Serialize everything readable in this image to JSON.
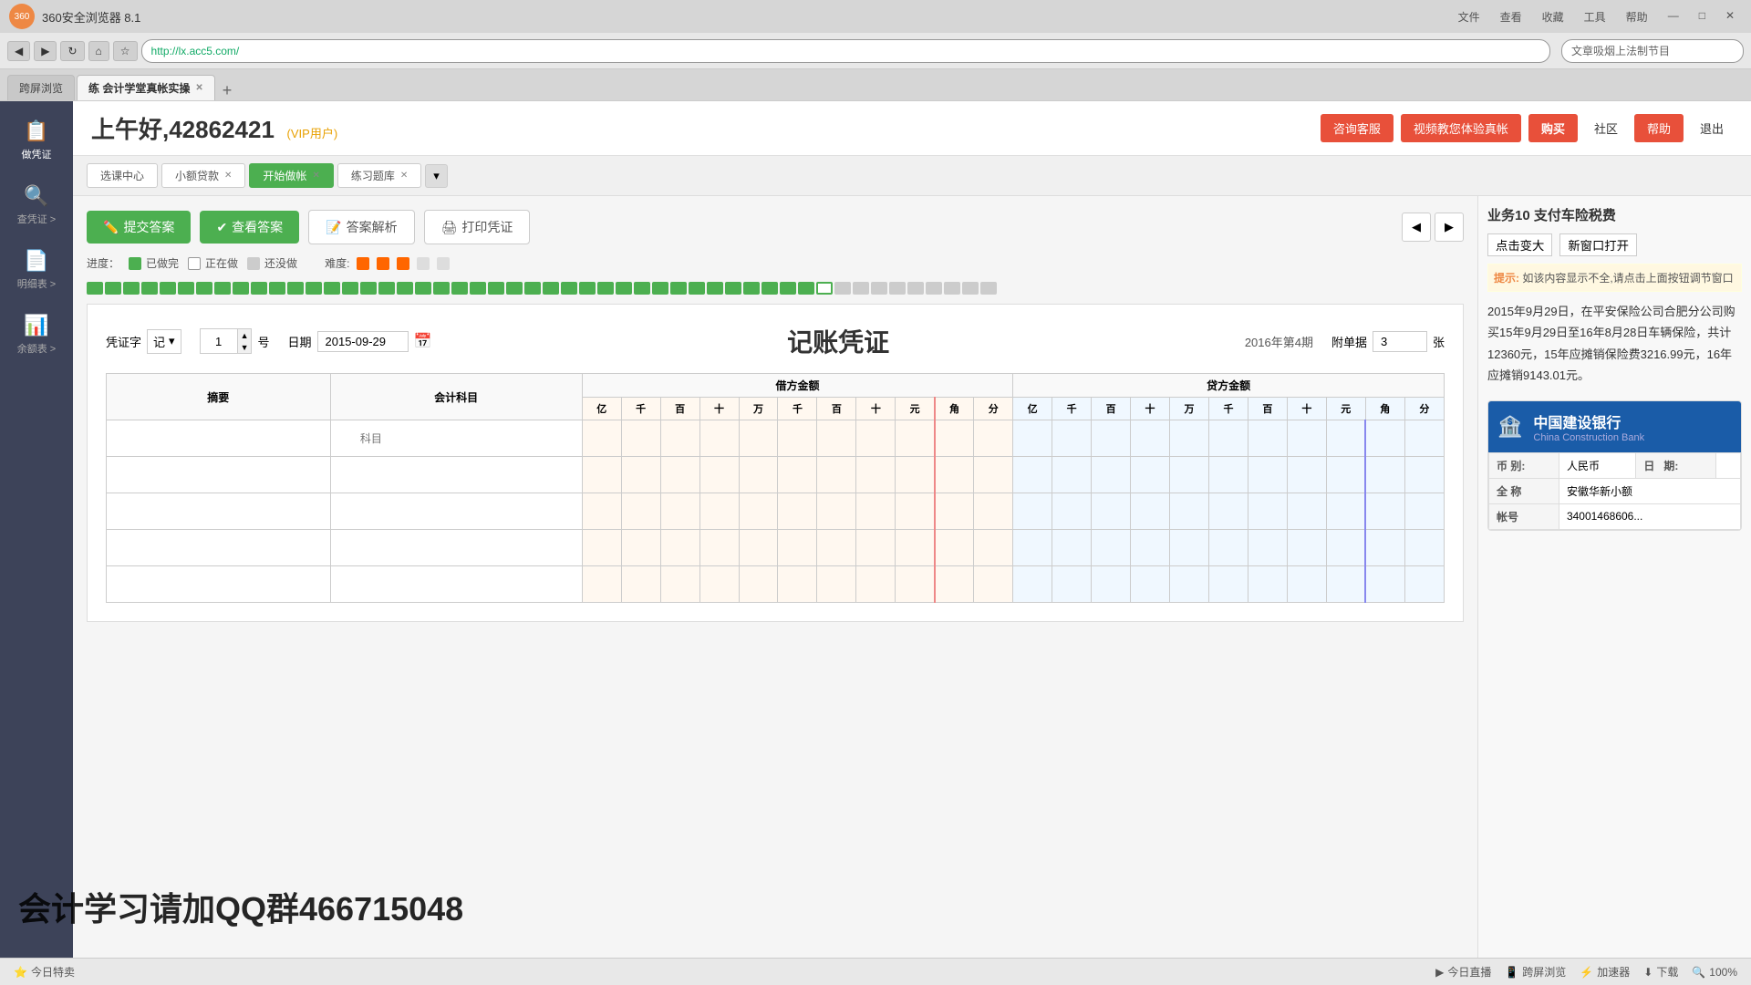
{
  "browser": {
    "title": "360安全浏览器 8.1",
    "url": "http://lx.acc5.com/",
    "search_placeholder": "文章吸烟上法制节目",
    "tabs": [
      {
        "label": "跨屏浏览",
        "active": false,
        "closable": false
      },
      {
        "label": "练 会计学堂真帐实操",
        "active": true,
        "closable": true
      }
    ],
    "window_controls": [
      "文件",
      "查看",
      "收藏",
      "工具",
      "帮助"
    ]
  },
  "header": {
    "greeting": "上午好,42862421",
    "vip_label": "(VIP用户)",
    "buttons": {
      "consult": "咨询客服",
      "video": "视频教您体验真帐",
      "buy": "购买",
      "community": "社区",
      "help": "帮助",
      "exit": "退出"
    }
  },
  "content_tabs": [
    {
      "label": "选课中心",
      "active": false,
      "closable": false
    },
    {
      "label": "小额贷款",
      "active": false,
      "closable": true
    },
    {
      "label": "开始做帐",
      "active": true,
      "closable": true
    },
    {
      "label": "练习题库",
      "active": false,
      "closable": true
    }
  ],
  "action_bar": {
    "submit": "提交答案",
    "answer": "查看答案",
    "analysis": "答案解析",
    "print": "打印凭证"
  },
  "progress": {
    "legend_done": "已做完",
    "legend_doing": "正在做",
    "legend_todo": "还没做",
    "difficulty_label": "难度:",
    "total_cells": 50,
    "done_cells": 40,
    "current_cell": 41
  },
  "voucher": {
    "type_label": "凭证字",
    "type_value": "记",
    "number_label": "号",
    "number_value": "1",
    "date_label": "日期",
    "date_value": "2015-09-29",
    "title": "记账凭证",
    "period": "2016年第4期",
    "attachment_label": "附单据",
    "attachment_value": "3",
    "attachment_unit": "张",
    "table": {
      "col_summary": "摘要",
      "col_account": "会计科目",
      "debit_header": "借方金额",
      "credit_header": "贷方金额",
      "num_headers": [
        "亿",
        "千",
        "百",
        "+",
        "万",
        "千",
        "百",
        "+",
        "元",
        "角",
        "分",
        "亿",
        "千",
        "百",
        "+",
        "万",
        "千",
        "百",
        "+",
        "元",
        "角",
        "分"
      ],
      "account_placeholder": "科目",
      "rows": [
        {
          "summary": "",
          "account": "",
          "debit": "",
          "credit": ""
        },
        {
          "summary": "",
          "account": "",
          "debit": "",
          "credit": ""
        },
        {
          "summary": "",
          "account": "",
          "debit": "",
          "credit": ""
        },
        {
          "summary": "",
          "account": "",
          "debit": "",
          "credit": ""
        },
        {
          "summary": "",
          "account": "",
          "debit": "",
          "credit": ""
        }
      ]
    }
  },
  "sidebar": {
    "items": [
      {
        "label": "做凭证",
        "icon": "📋"
      },
      {
        "label": "查凭证 >",
        "icon": "🔍"
      },
      {
        "label": "明细表 >",
        "icon": "📄"
      },
      {
        "label": "余额表 >",
        "icon": "📊"
      }
    ]
  },
  "right_panel": {
    "business_title": "业务10  支付车险税费",
    "zoom_label": "点击变大",
    "new_window_label": "新窗口打开",
    "hint_label": "提示:",
    "hint_text": "如该内容显示不全,请点击上面按钮调节窗口",
    "description": "2015年9月29日，在平安保险公司合肥分公司购买15年9月29日至16年8月28日车辆保险，共计12360元，15年应摊销保险费3216.99元，16年应摊销9143.01元。",
    "bank": {
      "name_cn": "中国建设银行",
      "name_en": "China Construction Bank",
      "currency_label": "币 别:",
      "currency_value": "人民币",
      "date_label": "日",
      "date_label2": "期:",
      "full_name_label": "全 称",
      "full_name_value": "安徽华新小额",
      "account_label": "帐号",
      "account_value": "34001468606..."
    }
  },
  "watermark": "会计学习请加QQ群466715048",
  "status_bar": {
    "special_offer": "今日特卖",
    "live": "今日直播",
    "cross_screen": "跨屏浏览",
    "accelerator": "加速器",
    "download": "下载",
    "zoom": "100%"
  }
}
